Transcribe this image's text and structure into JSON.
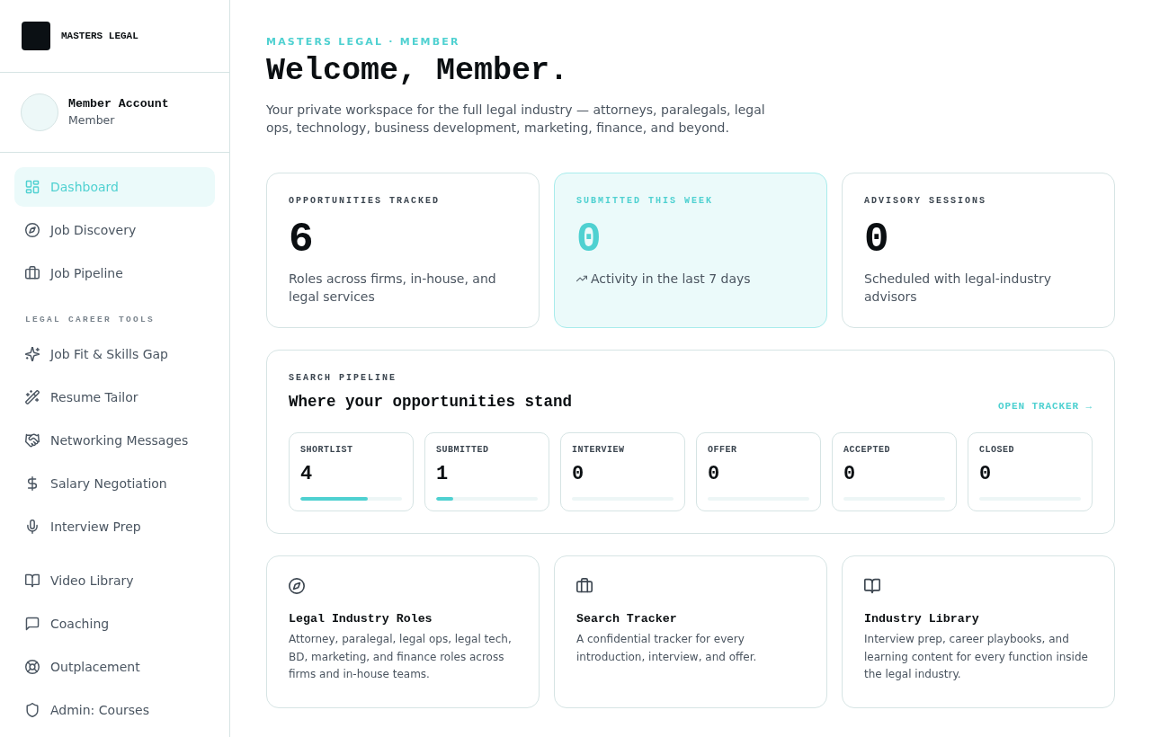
{
  "sidebar": {
    "brand": {
      "name": "MASTERS LEGAL"
    },
    "account": {
      "name": "Member Account",
      "role": "Member"
    },
    "sections": [
      {
        "items": [
          {
            "label": "Dashboard",
            "selected": true
          },
          {
            "label": "Job Discovery",
            "selected": false
          },
          {
            "label": "Job Pipeline",
            "selected": false
          }
        ]
      },
      {
        "title": "LEGAL CAREER TOOLS",
        "items": [
          {
            "label": "Job Fit & Skills Gap",
            "selected": false
          },
          {
            "label": "Resume Tailor",
            "selected": false
          },
          {
            "label": "Networking Messages",
            "selected": false
          },
          {
            "label": "Salary Negotiation",
            "selected": false
          },
          {
            "label": "Interview Prep",
            "selected": false
          }
        ]
      },
      {
        "items": [
          {
            "label": "Video Library",
            "selected": false
          },
          {
            "label": "Coaching",
            "selected": false
          },
          {
            "label": "Outplacement",
            "selected": false
          },
          {
            "label": "Admin: Courses",
            "selected": false
          }
        ]
      }
    ]
  },
  "main": {
    "eyebrow": "MASTERS LEGAL · MEMBER",
    "title": "Welcome, Member.",
    "intro": "Your private workspace for the full legal industry — attorneys, paralegals, legal ops, technology, business development, marketing, finance, and beyond.",
    "stats": [
      {
        "label": "OPPORTUNITIES TRACKED",
        "value": "6",
        "description": "Roles across firms, in-house, and legal services",
        "highlighted": false
      },
      {
        "label": "SUBMITTED THIS WEEK",
        "value": "0",
        "description": "Activity in the last 7 days",
        "highlighted": true
      },
      {
        "label": "ADVISORY SESSIONS",
        "value": "0",
        "description": "Scheduled with legal-industry advisors",
        "highlighted": false
      }
    ],
    "pipeline": {
      "eyebrow": "SEARCH PIPELINE",
      "title": "Where your opportunities stand",
      "link": "OPEN TRACKER →",
      "stages": [
        {
          "label": "SHORTLIST",
          "count": "4",
          "level": 0.667
        },
        {
          "label": "SUBMITTED",
          "count": "1",
          "level": 0.167
        },
        {
          "label": "INTERVIEW",
          "count": "0"
        },
        {
          "label": "OFFER",
          "count": "0"
        },
        {
          "label": "ACCEPTED",
          "count": "0"
        },
        {
          "label": "CLOSED",
          "count": "0"
        }
      ]
    },
    "features": [
      {
        "title": "Legal Industry Roles",
        "description": "Attorney, paralegal, legal ops, legal tech, BD, marketing, and finance roles across firms and in-house teams."
      },
      {
        "title": "Search Tracker",
        "description": "A confidential tracker for every introduction, interview, and offer."
      },
      {
        "title": "Industry Library",
        "description": "Interview prep, career playbooks, and learning content for every function inside the legal industry."
      }
    ]
  }
}
